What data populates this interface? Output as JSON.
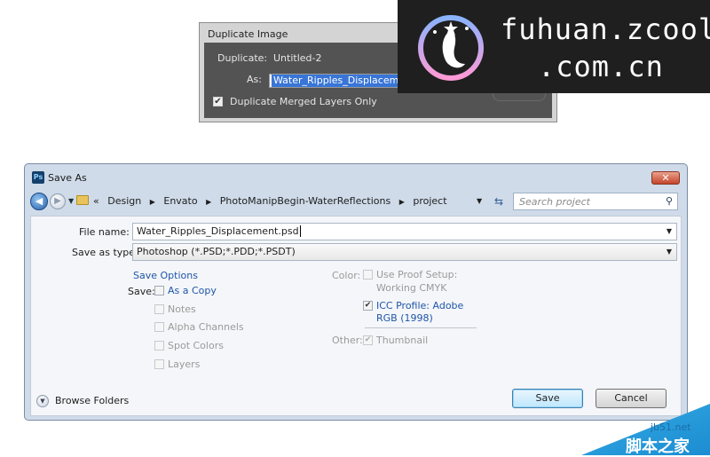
{
  "duplicate_dialog": {
    "title": "Duplicate Image",
    "duplicate_label": "Duplicate:",
    "duplicate_value": "Untitled-2",
    "as_label": "As:",
    "as_value": "Water_Ripples_Displacemen",
    "merged_checkbox_label": "Duplicate Merged Layers Only",
    "merged_checked": true
  },
  "watermark": {
    "line1": "fuhuan.zcool",
    "line2": ".com.cn"
  },
  "save_dialog": {
    "title": "Save As",
    "app_icon": "Ps",
    "close_label": "✕",
    "breadcrumb": {
      "overflow": "«",
      "items": [
        "Design",
        "Envato",
        "PhotoManipBegin-WaterReflections",
        "project"
      ]
    },
    "search_placeholder": "Search project",
    "file_name_label": "File name:",
    "file_name_value": "Water_Ripples_Displacement.psd",
    "save_type_label": "Save as type:",
    "save_type_value": "Photoshop (*.PSD;*.PDD;*.PSDT)",
    "save_options_heading": "Save Options",
    "save_label": "Save:",
    "save_options": [
      {
        "label": "As a Copy",
        "checked": false,
        "enabled": true
      },
      {
        "label": "Notes",
        "checked": false,
        "enabled": false
      },
      {
        "label": "Alpha Channels",
        "checked": false,
        "enabled": false
      },
      {
        "label": "Spot Colors",
        "checked": false,
        "enabled": false
      },
      {
        "label": "Layers",
        "checked": false,
        "enabled": false
      }
    ],
    "color_label": "Color:",
    "proof_setup_line1": "Use Proof Setup:",
    "proof_setup_line2": "Working CMYK",
    "icc_line1": "ICC Profile:  Adobe",
    "icc_line2": "RGB (1998)",
    "icc_checked": true,
    "other_label": "Other:",
    "thumbnail_label": "Thumbnail",
    "thumbnail_checked": true,
    "browse_folders_label": "Browse Folders",
    "save_button": "Save",
    "cancel_button": "Cancel"
  },
  "corner_watermark": {
    "url": "jb51.net",
    "name": "脚本之家"
  },
  "colors": {
    "dialog_frame": "#cfdbe9",
    "link_blue": "#1f55a8",
    "selection_blue": "#3875d7",
    "ps_dark": "#535353"
  }
}
